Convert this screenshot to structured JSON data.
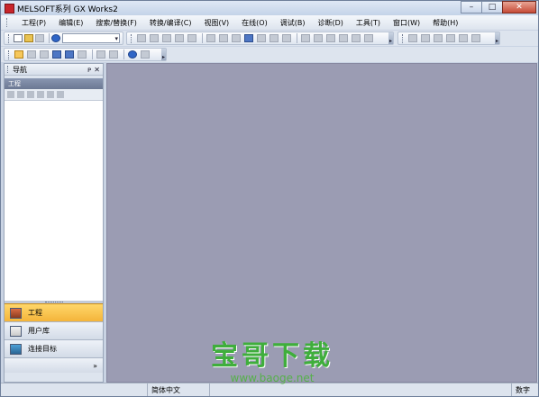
{
  "window": {
    "title": "MELSOFT系列 GX Works2",
    "controls": {
      "minimize": "–",
      "maximize": "□",
      "close": "✕"
    }
  },
  "menu": {
    "items": [
      "工程(P)",
      "编辑(E)",
      "搜索/替换(F)",
      "转换/编译(C)",
      "视图(V)",
      "在线(O)",
      "调试(B)",
      "诊断(D)",
      "工具(T)",
      "窗口(W)",
      "帮助(H)"
    ]
  },
  "toolbar": {
    "combo_value": "",
    "combo_arrow": "▾",
    "overflow": "▸"
  },
  "navigation": {
    "title": "导航",
    "pin": "ᴘ",
    "close": "✕",
    "section_header": "工程",
    "buttons": [
      {
        "label": "工程",
        "active": true,
        "icon": "project-icon"
      },
      {
        "label": "用户库",
        "active": false,
        "icon": "library-icon"
      },
      {
        "label": "连接目标",
        "active": false,
        "icon": "connection-icon"
      }
    ],
    "more": "»"
  },
  "statusbar": {
    "language": "简体中文",
    "num": "数字"
  },
  "watermark": {
    "title": "宝哥下载",
    "url": "www.baoge.net"
  },
  "colors": {
    "workspace": "#9b9cb3",
    "active_nav": "#f4b43a",
    "watermark": "#3fae3c"
  }
}
